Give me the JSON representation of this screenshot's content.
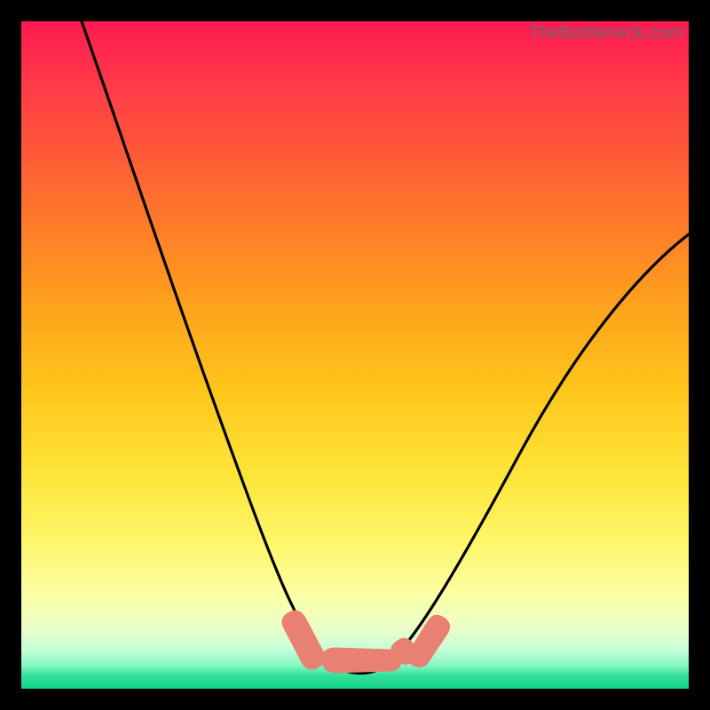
{
  "watermark": "TheBottleneck.com",
  "colors": {
    "frame": "#000000",
    "curve": "#000000",
    "blob": "#e98074",
    "gradient_top": "#ff1a52",
    "gradient_bottom": "#11d388"
  },
  "chart_data": {
    "type": "line",
    "title": "",
    "xlabel": "",
    "ylabel": "",
    "xlim": [
      0,
      100
    ],
    "ylim": [
      0,
      100
    ],
    "note": "Axes are unlabeled in the image; values are estimated from pixel positions on a 0–100 normalized scale (origin at bottom-left). The curve shape is a V with rounded bottom around x≈46–56.",
    "series": [
      {
        "name": "bottleneck-curve",
        "x": [
          9,
          12,
          16,
          20,
          24,
          28,
          32,
          36,
          40,
          43,
          46,
          49,
          52,
          55,
          58,
          62,
          67,
          73,
          80,
          88,
          96,
          100
        ],
        "y": [
          100,
          90,
          78,
          66,
          55,
          44,
          34,
          24,
          15,
          9,
          4.5,
          2.6,
          2.4,
          3.2,
          5.5,
          10,
          17,
          27,
          39,
          52,
          63,
          68
        ]
      }
    ],
    "annotations": [
      {
        "name": "blob-left",
        "shape": "capsule",
        "x_range": [
          40.5,
          44.5
        ],
        "y_range": [
          5.0,
          11.0
        ]
      },
      {
        "name": "blob-bottom",
        "shape": "capsule",
        "x_range": [
          44.0,
          55.5
        ],
        "y_range": [
          2.0,
          5.0
        ]
      },
      {
        "name": "blob-right",
        "shape": "capsule",
        "x_range": [
          55.0,
          58.5
        ],
        "y_range": [
          4.5,
          8.5
        ]
      }
    ]
  }
}
